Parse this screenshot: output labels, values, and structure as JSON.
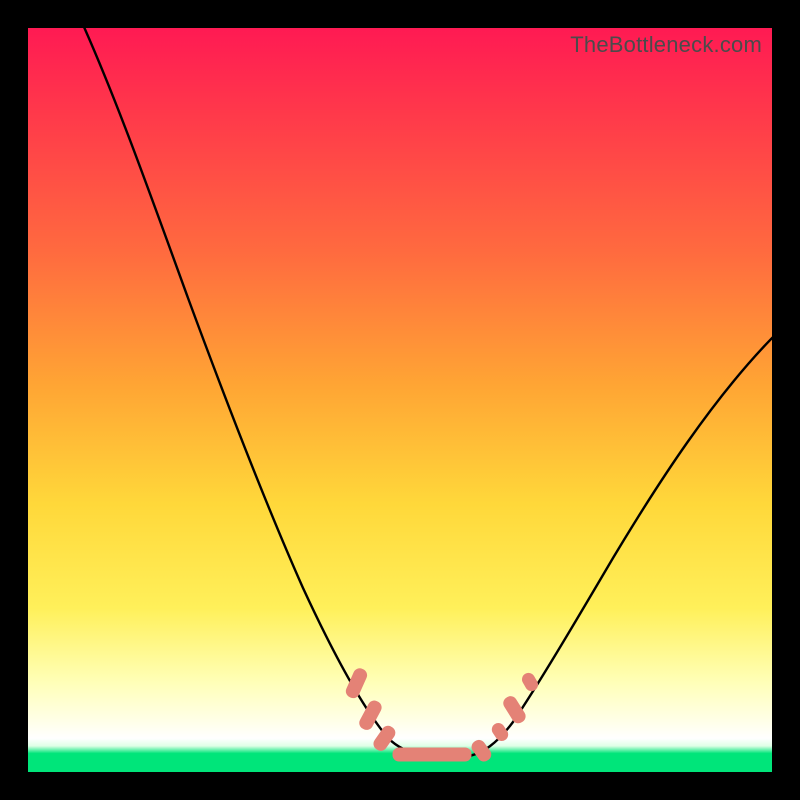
{
  "watermark": "TheBottleneck.com",
  "colors": {
    "frame_border": "#000000",
    "curve_stroke": "#000000",
    "marker_fill": "#e48276",
    "green_band": "#00e57a",
    "gradient_top": "#ff1a53",
    "gradient_mid": "#ffd83a",
    "gradient_bottom_white": "#ffffff"
  },
  "chart_data": {
    "type": "line",
    "title": "",
    "xlabel": "",
    "ylabel": "",
    "xlim": [
      0,
      100
    ],
    "ylim": [
      0,
      100
    ],
    "grid": false,
    "legend": false,
    "note": "Bottleneck-style V curve. Units are percent of plot width (x) and percent of plot height (y, 0 at bottom). Values estimated from pixel geometry — no axis ticks are shown in the image.",
    "series": [
      {
        "name": "bottleneck-curve",
        "x": [
          7,
          13,
          19,
          25,
          30,
          35,
          38,
          41,
          44,
          47,
          50,
          54,
          58,
          62,
          66,
          70,
          75,
          82,
          90,
          100
        ],
        "values": [
          100,
          87,
          74,
          61,
          49,
          38,
          29,
          20,
          12,
          6,
          3,
          2,
          2,
          3,
          6,
          12,
          20,
          31,
          43,
          58
        ]
      }
    ],
    "markers": {
      "name": "highlighted-points",
      "comment": "Short salmon-colored overlay segments near the trough of the curve",
      "points": [
        {
          "x": 44.5,
          "y": 11
        },
        {
          "x": 46.5,
          "y": 6
        },
        {
          "x": 48.0,
          "y": 4
        },
        {
          "x": 52.0,
          "y": 2
        },
        {
          "x": 56.0,
          "y": 2
        },
        {
          "x": 60.0,
          "y": 2.5
        },
        {
          "x": 63.0,
          "y": 4
        },
        {
          "x": 66.0,
          "y": 9
        },
        {
          "x": 67.5,
          "y": 12
        }
      ]
    }
  }
}
